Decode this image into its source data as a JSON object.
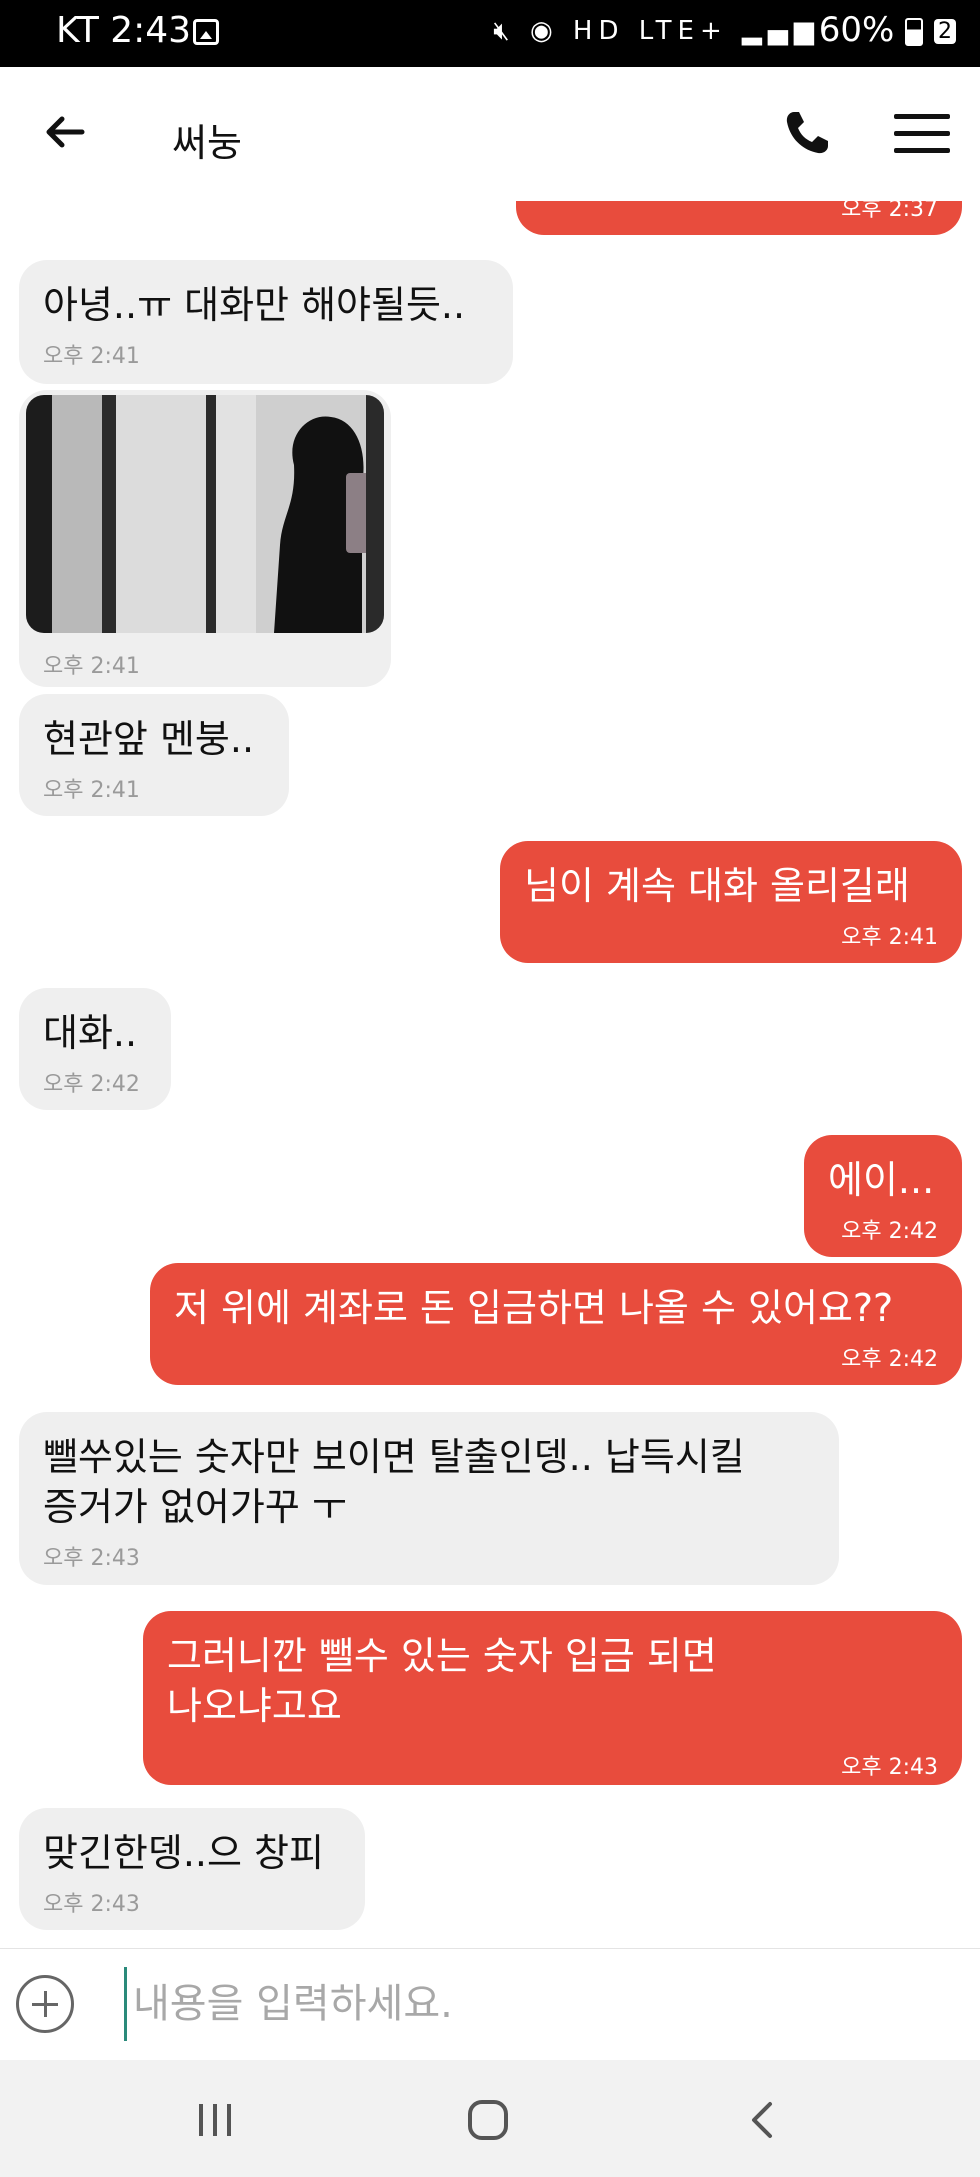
{
  "status_bar": {
    "carrier_time": "KT 2:43",
    "network": "HD LTE+",
    "battery": "60%",
    "badge": "2"
  },
  "header": {
    "title": "써눙"
  },
  "messages": [
    {
      "direction": "out",
      "text": "",
      "time": "오후 2:37"
    },
    {
      "direction": "in",
      "text": "아녕..ㅠ 대화만 해야될듯..",
      "time": "오후 2:41"
    },
    {
      "direction": "in",
      "type": "photo",
      "time": "오후 2:41"
    },
    {
      "direction": "in",
      "text": "현관앞 멘붕..",
      "time": "오후 2:41"
    },
    {
      "direction": "out",
      "text": "님이 계속 대화 올리길래",
      "time": "오후 2:41"
    },
    {
      "direction": "in",
      "text": "대화..",
      "time": "오후 2:42"
    },
    {
      "direction": "out",
      "text": "에이...",
      "time": "오후 2:42"
    },
    {
      "direction": "out",
      "text": "저 위에 계좌로 돈 입금하면 나올 수 있어요??",
      "time": "오후 2:42"
    },
    {
      "direction": "in",
      "text": "뺄쑤있는 숫자만 보이면 탈출인뎅.. 납득시킬\n증거가 없어가꾸 ㅜ",
      "time": "오후 2:43"
    },
    {
      "direction": "out",
      "text": "그러니깐 뺄수 있는 숫자 입금 되면\n나오냐고요",
      "time": "오후 2:43"
    },
    {
      "direction": "in",
      "text": "맞긴한뎅..으 창피",
      "time": "오후 2:43"
    }
  ],
  "input": {
    "placeholder": "내용을 입력하세요."
  }
}
